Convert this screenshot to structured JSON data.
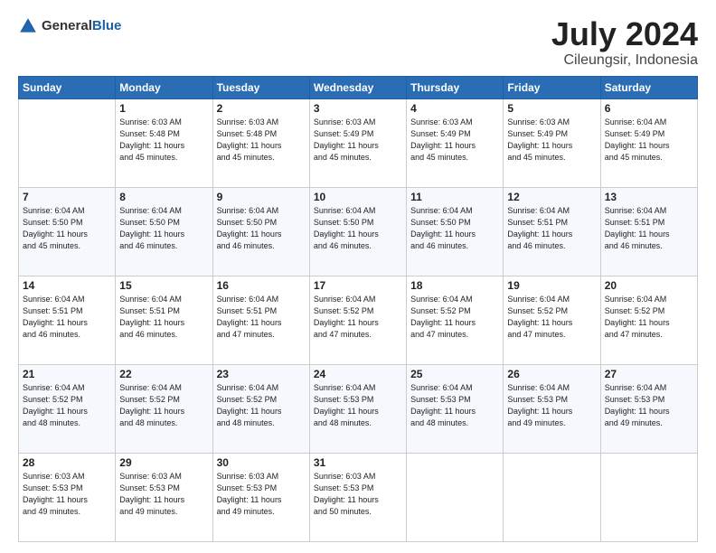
{
  "header": {
    "logo": {
      "general": "General",
      "blue": "Blue"
    },
    "title": "July 2024",
    "location": "Cileungsir, Indonesia"
  },
  "days_of_week": [
    "Sunday",
    "Monday",
    "Tuesday",
    "Wednesday",
    "Thursday",
    "Friday",
    "Saturday"
  ],
  "weeks": [
    [
      {
        "day": "",
        "info": ""
      },
      {
        "day": "1",
        "info": "Sunrise: 6:03 AM\nSunset: 5:48 PM\nDaylight: 11 hours\nand 45 minutes."
      },
      {
        "day": "2",
        "info": "Sunrise: 6:03 AM\nSunset: 5:48 PM\nDaylight: 11 hours\nand 45 minutes."
      },
      {
        "day": "3",
        "info": "Sunrise: 6:03 AM\nSunset: 5:49 PM\nDaylight: 11 hours\nand 45 minutes."
      },
      {
        "day": "4",
        "info": "Sunrise: 6:03 AM\nSunset: 5:49 PM\nDaylight: 11 hours\nand 45 minutes."
      },
      {
        "day": "5",
        "info": "Sunrise: 6:03 AM\nSunset: 5:49 PM\nDaylight: 11 hours\nand 45 minutes."
      },
      {
        "day": "6",
        "info": "Sunrise: 6:04 AM\nSunset: 5:49 PM\nDaylight: 11 hours\nand 45 minutes."
      }
    ],
    [
      {
        "day": "7",
        "info": "Sunrise: 6:04 AM\nSunset: 5:50 PM\nDaylight: 11 hours\nand 45 minutes."
      },
      {
        "day": "8",
        "info": "Sunrise: 6:04 AM\nSunset: 5:50 PM\nDaylight: 11 hours\nand 46 minutes."
      },
      {
        "day": "9",
        "info": "Sunrise: 6:04 AM\nSunset: 5:50 PM\nDaylight: 11 hours\nand 46 minutes."
      },
      {
        "day": "10",
        "info": "Sunrise: 6:04 AM\nSunset: 5:50 PM\nDaylight: 11 hours\nand 46 minutes."
      },
      {
        "day": "11",
        "info": "Sunrise: 6:04 AM\nSunset: 5:50 PM\nDaylight: 11 hours\nand 46 minutes."
      },
      {
        "day": "12",
        "info": "Sunrise: 6:04 AM\nSunset: 5:51 PM\nDaylight: 11 hours\nand 46 minutes."
      },
      {
        "day": "13",
        "info": "Sunrise: 6:04 AM\nSunset: 5:51 PM\nDaylight: 11 hours\nand 46 minutes."
      }
    ],
    [
      {
        "day": "14",
        "info": "Sunrise: 6:04 AM\nSunset: 5:51 PM\nDaylight: 11 hours\nand 46 minutes."
      },
      {
        "day": "15",
        "info": "Sunrise: 6:04 AM\nSunset: 5:51 PM\nDaylight: 11 hours\nand 46 minutes."
      },
      {
        "day": "16",
        "info": "Sunrise: 6:04 AM\nSunset: 5:51 PM\nDaylight: 11 hours\nand 47 minutes."
      },
      {
        "day": "17",
        "info": "Sunrise: 6:04 AM\nSunset: 5:52 PM\nDaylight: 11 hours\nand 47 minutes."
      },
      {
        "day": "18",
        "info": "Sunrise: 6:04 AM\nSunset: 5:52 PM\nDaylight: 11 hours\nand 47 minutes."
      },
      {
        "day": "19",
        "info": "Sunrise: 6:04 AM\nSunset: 5:52 PM\nDaylight: 11 hours\nand 47 minutes."
      },
      {
        "day": "20",
        "info": "Sunrise: 6:04 AM\nSunset: 5:52 PM\nDaylight: 11 hours\nand 47 minutes."
      }
    ],
    [
      {
        "day": "21",
        "info": "Sunrise: 6:04 AM\nSunset: 5:52 PM\nDaylight: 11 hours\nand 48 minutes."
      },
      {
        "day": "22",
        "info": "Sunrise: 6:04 AM\nSunset: 5:52 PM\nDaylight: 11 hours\nand 48 minutes."
      },
      {
        "day": "23",
        "info": "Sunrise: 6:04 AM\nSunset: 5:52 PM\nDaylight: 11 hours\nand 48 minutes."
      },
      {
        "day": "24",
        "info": "Sunrise: 6:04 AM\nSunset: 5:53 PM\nDaylight: 11 hours\nand 48 minutes."
      },
      {
        "day": "25",
        "info": "Sunrise: 6:04 AM\nSunset: 5:53 PM\nDaylight: 11 hours\nand 48 minutes."
      },
      {
        "day": "26",
        "info": "Sunrise: 6:04 AM\nSunset: 5:53 PM\nDaylight: 11 hours\nand 49 minutes."
      },
      {
        "day": "27",
        "info": "Sunrise: 6:04 AM\nSunset: 5:53 PM\nDaylight: 11 hours\nand 49 minutes."
      }
    ],
    [
      {
        "day": "28",
        "info": "Sunrise: 6:03 AM\nSunset: 5:53 PM\nDaylight: 11 hours\nand 49 minutes."
      },
      {
        "day": "29",
        "info": "Sunrise: 6:03 AM\nSunset: 5:53 PM\nDaylight: 11 hours\nand 49 minutes."
      },
      {
        "day": "30",
        "info": "Sunrise: 6:03 AM\nSunset: 5:53 PM\nDaylight: 11 hours\nand 49 minutes."
      },
      {
        "day": "31",
        "info": "Sunrise: 6:03 AM\nSunset: 5:53 PM\nDaylight: 11 hours\nand 50 minutes."
      },
      {
        "day": "",
        "info": ""
      },
      {
        "day": "",
        "info": ""
      },
      {
        "day": "",
        "info": ""
      }
    ]
  ]
}
